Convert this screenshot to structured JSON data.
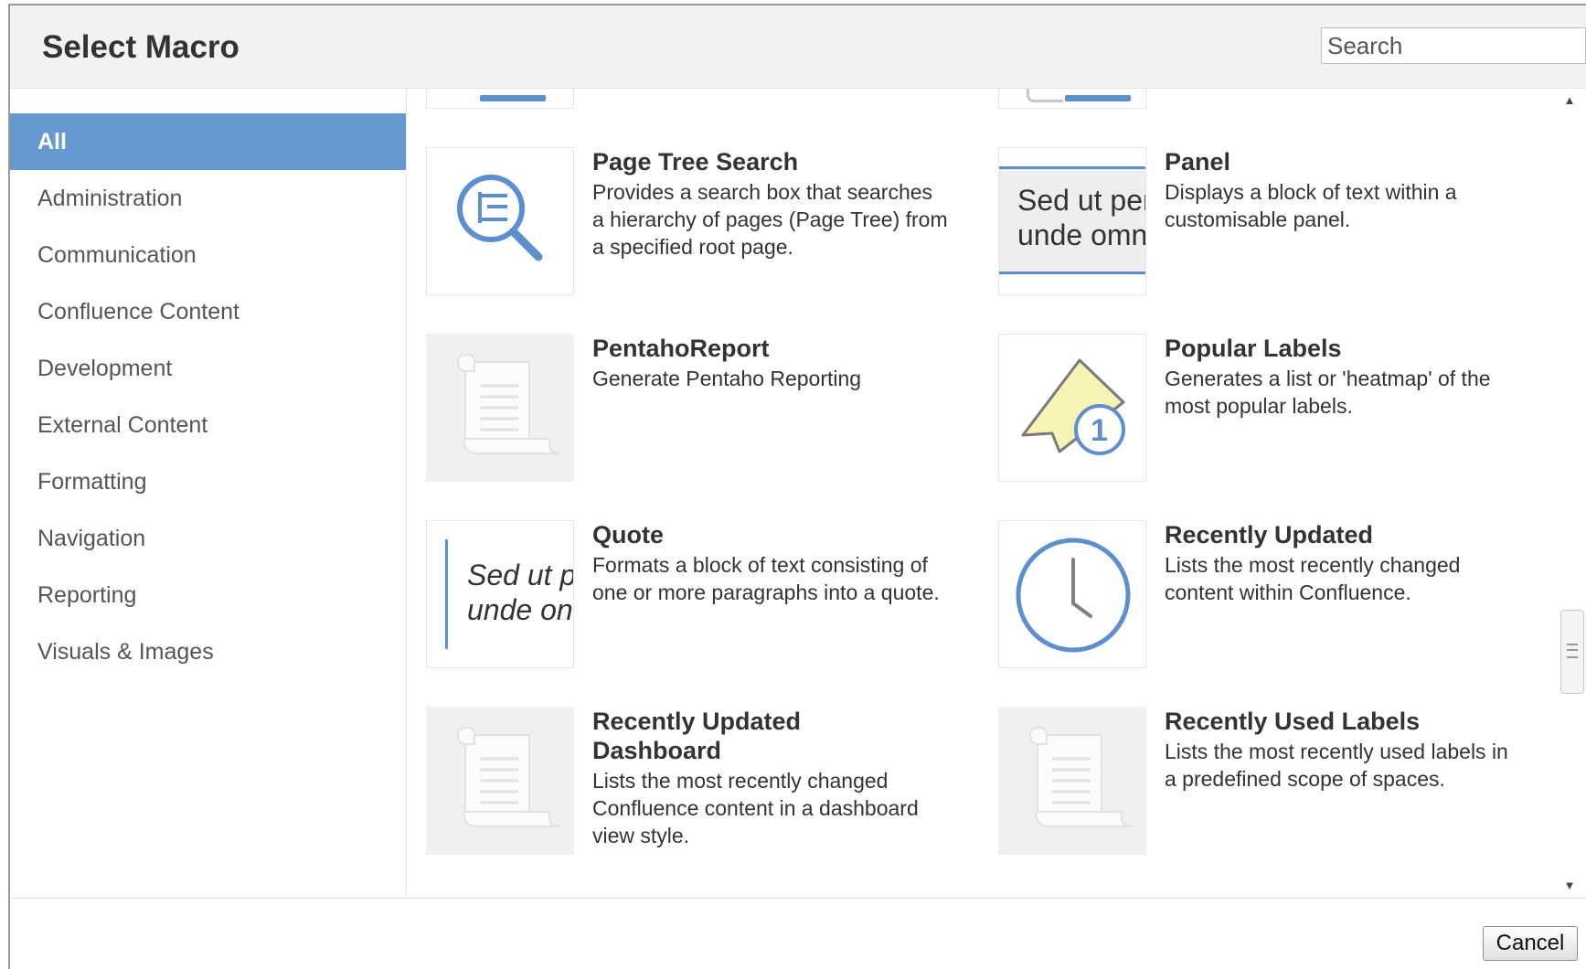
{
  "dialog": {
    "title": "Select Macro",
    "search_placeholder": "Search",
    "cancel_label": "Cancel"
  },
  "categories": [
    {
      "label": "All",
      "active": true
    },
    {
      "label": "Administration"
    },
    {
      "label": "Communication"
    },
    {
      "label": "Confluence Content"
    },
    {
      "label": "Development"
    },
    {
      "label": "External Content"
    },
    {
      "label": "Formatting"
    },
    {
      "label": "Navigation"
    },
    {
      "label": "Reporting"
    },
    {
      "label": "Visuals & Images"
    }
  ],
  "macros": [
    {
      "name": "Page Tree Search",
      "description": "Provides a search box that searches a hierarchy of pages (Page Tree) from a specified root page.",
      "icon": "page-tree-search-icon"
    },
    {
      "name": "Panel",
      "description": "Displays a block of text within a customisable panel.",
      "icon": "panel-preview",
      "preview_text": [
        "Sed ut per",
        "unde omn"
      ]
    },
    {
      "name": "PentahoReport",
      "description": "Generate Pentaho Reporting",
      "icon": "scroll-icon"
    },
    {
      "name": "Popular Labels",
      "description": "Generates a list or 'heatmap' of the most popular labels.",
      "icon": "label-ribbon-icon",
      "badge": "1"
    },
    {
      "name": "Quote",
      "description": "Formats a block of text consisting of one or more paragraphs into a quote.",
      "icon": "quote-preview",
      "preview_text": [
        "Sed ut p",
        "unde on"
      ]
    },
    {
      "name": "Recently Updated",
      "description": "Lists the most recently changed content within Confluence.",
      "icon": "clock-icon"
    },
    {
      "name": "Recently Updated Dashboard",
      "description": "Lists the most recently changed Confluence content in a dashboard view style.",
      "icon": "scroll-icon"
    },
    {
      "name": "Recently Used Labels",
      "description": "Lists the most recently used labels in a predefined scope of spaces.",
      "icon": "scroll-icon"
    }
  ],
  "colors": {
    "accent": "#6698d2",
    "icon_blue": "#5b8fcf",
    "label_yellow": "#f6f3b4"
  }
}
